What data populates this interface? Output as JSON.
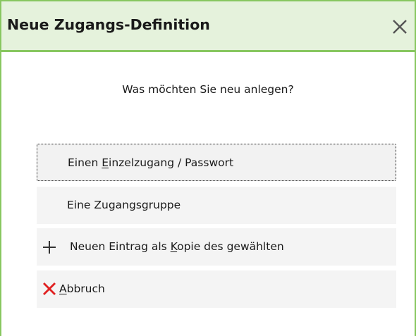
{
  "window": {
    "title": "Neue Zugangs-Definition",
    "accent_color": "#88c760",
    "titlebar_color": "#e5f2dc"
  },
  "close_icon": "close-icon",
  "prompt": "Was möchten Sie neu anlegen?",
  "options": [
    {
      "before": "Einen ",
      "mnemonic": "E",
      "after": "inzelzugang / Passwort",
      "focused": true
    },
    {
      "before": "Eine Zugangsgruppe",
      "mnemonic": "",
      "after": ""
    },
    {
      "before": "Neuen Eintrag als ",
      "mnemonic": "K",
      "after": "opie des gewählten",
      "icon": "plus-icon"
    },
    {
      "before": "",
      "mnemonic": "A",
      "after": "bbruch",
      "icon": "cancel-x-icon",
      "icon_color": "#e02020"
    }
  ]
}
